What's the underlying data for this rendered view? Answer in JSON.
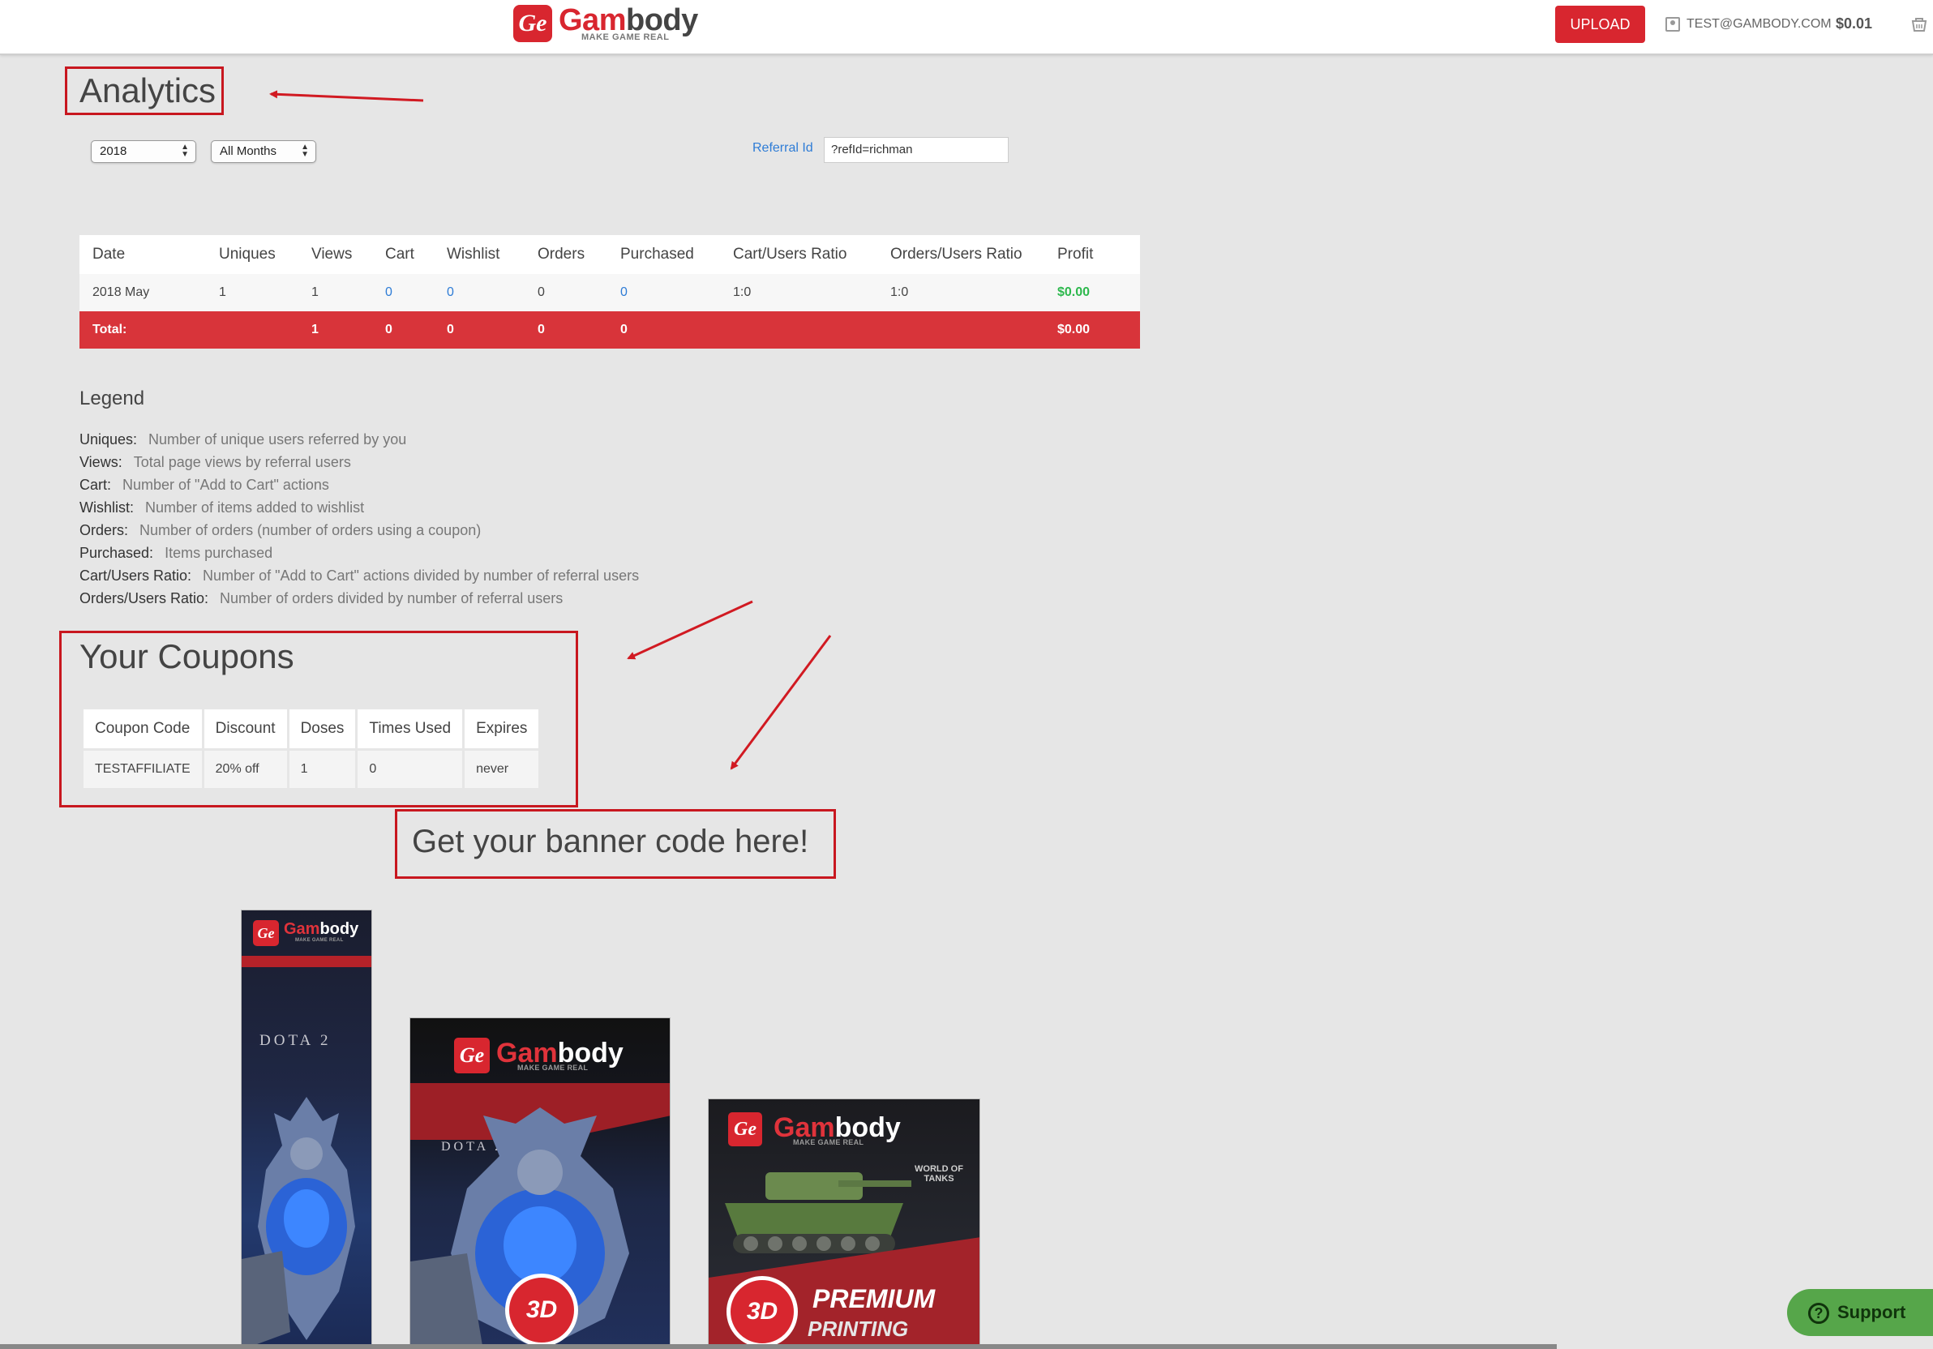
{
  "header": {
    "logo_mark": "Ge",
    "logo_word_red": "Gam",
    "logo_word_dark": "body",
    "logo_tagline": "MAKE GAME REAL",
    "upload_label": "UPLOAD",
    "user_email": "TEST@GAMBODY.COM",
    "balance": "$0.01",
    "user_icon": "user-icon",
    "cart_icon": "cart-icon"
  },
  "page_title": "Analytics",
  "filters": {
    "year": "2018",
    "month": "All Months",
    "referral_label": "Referral Id",
    "referral_value": "?refId=richman"
  },
  "stats_table": {
    "columns": [
      "Date",
      "Uniques",
      "Views",
      "Cart",
      "Wishlist",
      "Orders",
      "Purchased",
      "Cart/Users Ratio",
      "Orders/Users Ratio",
      "Profit"
    ],
    "rows": [
      [
        "2018 May",
        "1",
        "1",
        "0",
        "0",
        "0",
        "0",
        "1:0",
        "1:0",
        "$0.00"
      ]
    ],
    "total": [
      "Total:",
      "",
      "1",
      "0",
      "0",
      "0",
      "0",
      "",
      "",
      "$0.00"
    ]
  },
  "legend": {
    "title": "Legend",
    "items": [
      {
        "key": "Uniques:",
        "value": "Number of unique users referred by you"
      },
      {
        "key": "Views:",
        "value": "Total page views by referral users"
      },
      {
        "key": "Cart:",
        "value": "Number of \"Add to Cart\" actions"
      },
      {
        "key": "Wishlist:",
        "value": "Number of items added to wishlist"
      },
      {
        "key": "Orders:",
        "value": "Number of orders (number of orders using a coupon)"
      },
      {
        "key": "Purchased:",
        "value": "Items purchased"
      },
      {
        "key": "Cart/Users Ratio:",
        "value": "Number of \"Add to Cart\" actions divided by number of referral users"
      },
      {
        "key": "Orders/Users Ratio:",
        "value": "Number of orders divided by number of referral users"
      }
    ]
  },
  "coupons": {
    "title": "Your Coupons",
    "columns": [
      "Coupon Code",
      "Discount",
      "Doses",
      "Times Used",
      "Expires"
    ],
    "rows": [
      [
        "TESTAFFILIATE",
        "20% off",
        "1",
        "0",
        "never"
      ]
    ]
  },
  "banner_heading": "Get your banner code here!",
  "banners": {
    "dota_label": "DOTA 2",
    "badge_3d": "3D",
    "premium": "PREMIUM",
    "printing": "PRINTING",
    "wot_label": "WORLD OF TANKS"
  },
  "support_label": "Support",
  "colors": {
    "brand_red": "#d8262f",
    "link_blue": "#2e7cd6",
    "profit_green": "#2db84d",
    "support_green": "#56a64a"
  }
}
